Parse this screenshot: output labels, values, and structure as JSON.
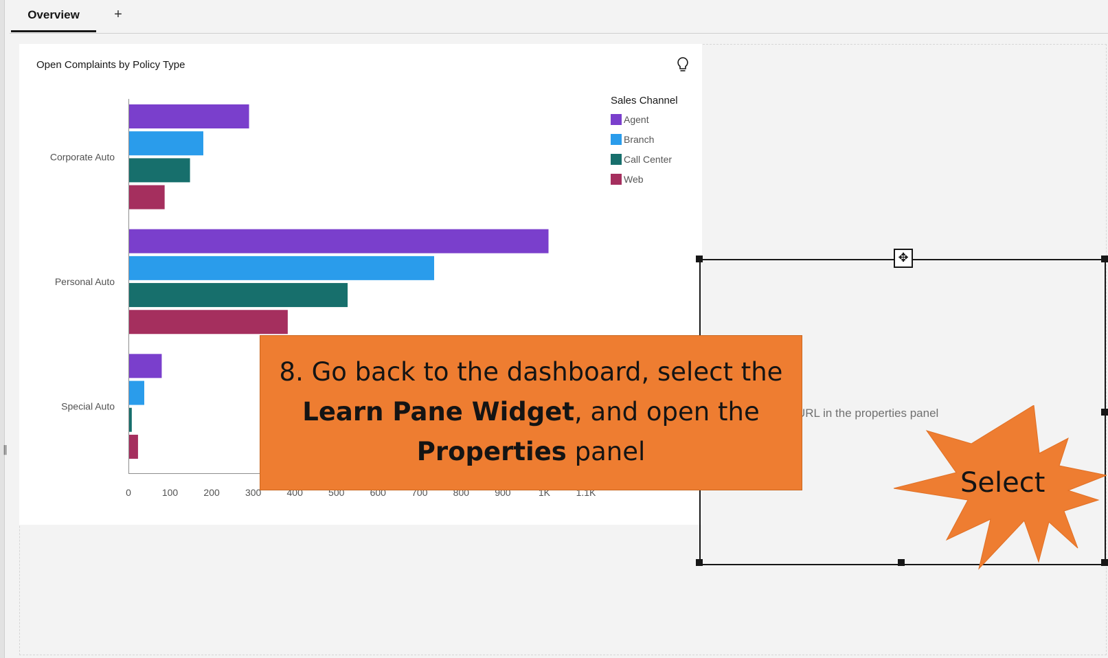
{
  "tabs": {
    "active": "Overview",
    "add": "+"
  },
  "widget": {
    "title": "Open Complaints by Policy Type",
    "legend_title": "Sales Channel"
  },
  "chart_data": {
    "type": "bar",
    "orientation": "horizontal",
    "title": "Open Complaints by Policy Type",
    "categories": [
      "Corporate Auto",
      "Personal Auto",
      "Special Auto"
    ],
    "series": [
      {
        "name": "Agent",
        "color": "#7a3fcc",
        "values": [
          290,
          1010,
          80
        ]
      },
      {
        "name": "Branch",
        "color": "#2a9ceb",
        "values": [
          180,
          735,
          38
        ]
      },
      {
        "name": "Call Center",
        "color": "#176f6c",
        "values": [
          148,
          527,
          8
        ]
      },
      {
        "name": "Web",
        "color": "#a52f5e",
        "values": [
          87,
          383,
          23
        ]
      }
    ],
    "xticks": [
      "0",
      "100",
      "200",
      "300",
      "400",
      "500",
      "600",
      "700",
      "800",
      "900",
      "1K",
      "1.1K"
    ],
    "xlim": [
      0,
      1100
    ],
    "legend_position": "top-right",
    "grid": false
  },
  "learn_pane": {
    "hint": "URL in the properties panel"
  },
  "callout": {
    "part1": "8. Go back to the dashboard, select the ",
    "bold1": "Learn Pane Widget",
    "part2": ", and open the ",
    "bold2": "Properties",
    "part3": " panel"
  },
  "burst_label": "Select",
  "icons": {
    "bulb": "lightbulb-icon",
    "move": "move-icon",
    "rail": "collapse-handle-icon"
  }
}
